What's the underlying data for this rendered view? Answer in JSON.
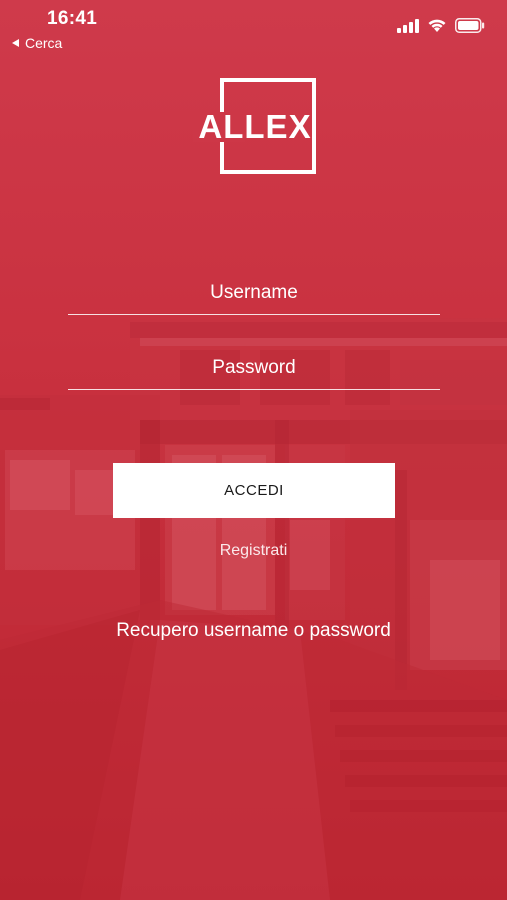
{
  "status_bar": {
    "time": "16:41",
    "back_label": "Cerca",
    "icons": [
      "signal-icon",
      "wifi-icon",
      "battery-icon"
    ]
  },
  "logo": {
    "text": "ALLEX"
  },
  "form": {
    "username_placeholder": "Username",
    "password_placeholder": "Password",
    "login_button_label": "ACCEDI",
    "register_link_label": "Registrati",
    "recover_link_label": "Recupero username o password"
  },
  "colors": {
    "background_tint": "#c8303e",
    "button_background": "#ffffff",
    "button_text": "#1a1a1a",
    "text": "#ffffff"
  }
}
